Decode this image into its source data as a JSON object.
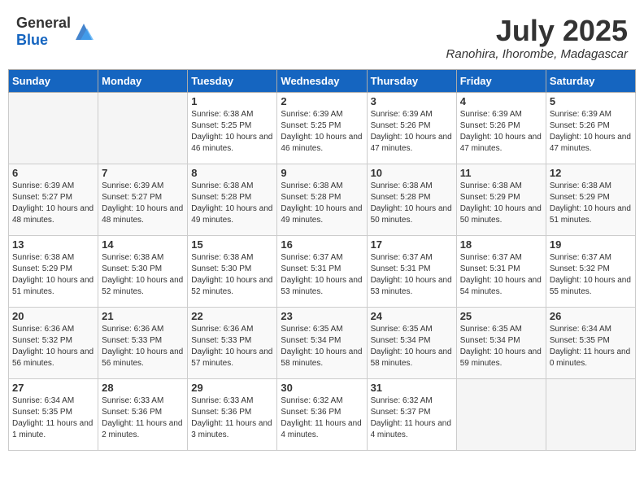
{
  "header": {
    "logo_general": "General",
    "logo_blue": "Blue",
    "month_year": "July 2025",
    "location": "Ranohira, Ihorombe, Madagascar"
  },
  "days_of_week": [
    "Sunday",
    "Monday",
    "Tuesday",
    "Wednesday",
    "Thursday",
    "Friday",
    "Saturday"
  ],
  "weeks": [
    [
      {
        "day": "",
        "empty": true
      },
      {
        "day": "",
        "empty": true
      },
      {
        "day": "1",
        "sunrise": "6:38 AM",
        "sunset": "5:25 PM",
        "daylight": "10 hours and 46 minutes."
      },
      {
        "day": "2",
        "sunrise": "6:39 AM",
        "sunset": "5:25 PM",
        "daylight": "10 hours and 46 minutes."
      },
      {
        "day": "3",
        "sunrise": "6:39 AM",
        "sunset": "5:26 PM",
        "daylight": "10 hours and 47 minutes."
      },
      {
        "day": "4",
        "sunrise": "6:39 AM",
        "sunset": "5:26 PM",
        "daylight": "10 hours and 47 minutes."
      },
      {
        "day": "5",
        "sunrise": "6:39 AM",
        "sunset": "5:26 PM",
        "daylight": "10 hours and 47 minutes."
      }
    ],
    [
      {
        "day": "6",
        "sunrise": "6:39 AM",
        "sunset": "5:27 PM",
        "daylight": "10 hours and 48 minutes."
      },
      {
        "day": "7",
        "sunrise": "6:39 AM",
        "sunset": "5:27 PM",
        "daylight": "10 hours and 48 minutes."
      },
      {
        "day": "8",
        "sunrise": "6:38 AM",
        "sunset": "5:28 PM",
        "daylight": "10 hours and 49 minutes."
      },
      {
        "day": "9",
        "sunrise": "6:38 AM",
        "sunset": "5:28 PM",
        "daylight": "10 hours and 49 minutes."
      },
      {
        "day": "10",
        "sunrise": "6:38 AM",
        "sunset": "5:28 PM",
        "daylight": "10 hours and 50 minutes."
      },
      {
        "day": "11",
        "sunrise": "6:38 AM",
        "sunset": "5:29 PM",
        "daylight": "10 hours and 50 minutes."
      },
      {
        "day": "12",
        "sunrise": "6:38 AM",
        "sunset": "5:29 PM",
        "daylight": "10 hours and 51 minutes."
      }
    ],
    [
      {
        "day": "13",
        "sunrise": "6:38 AM",
        "sunset": "5:29 PM",
        "daylight": "10 hours and 51 minutes."
      },
      {
        "day": "14",
        "sunrise": "6:38 AM",
        "sunset": "5:30 PM",
        "daylight": "10 hours and 52 minutes."
      },
      {
        "day": "15",
        "sunrise": "6:38 AM",
        "sunset": "5:30 PM",
        "daylight": "10 hours and 52 minutes."
      },
      {
        "day": "16",
        "sunrise": "6:37 AM",
        "sunset": "5:31 PM",
        "daylight": "10 hours and 53 minutes."
      },
      {
        "day": "17",
        "sunrise": "6:37 AM",
        "sunset": "5:31 PM",
        "daylight": "10 hours and 53 minutes."
      },
      {
        "day": "18",
        "sunrise": "6:37 AM",
        "sunset": "5:31 PM",
        "daylight": "10 hours and 54 minutes."
      },
      {
        "day": "19",
        "sunrise": "6:37 AM",
        "sunset": "5:32 PM",
        "daylight": "10 hours and 55 minutes."
      }
    ],
    [
      {
        "day": "20",
        "sunrise": "6:36 AM",
        "sunset": "5:32 PM",
        "daylight": "10 hours and 56 minutes."
      },
      {
        "day": "21",
        "sunrise": "6:36 AM",
        "sunset": "5:33 PM",
        "daylight": "10 hours and 56 minutes."
      },
      {
        "day": "22",
        "sunrise": "6:36 AM",
        "sunset": "5:33 PM",
        "daylight": "10 hours and 57 minutes."
      },
      {
        "day": "23",
        "sunrise": "6:35 AM",
        "sunset": "5:34 PM",
        "daylight": "10 hours and 58 minutes."
      },
      {
        "day": "24",
        "sunrise": "6:35 AM",
        "sunset": "5:34 PM",
        "daylight": "10 hours and 58 minutes."
      },
      {
        "day": "25",
        "sunrise": "6:35 AM",
        "sunset": "5:34 PM",
        "daylight": "10 hours and 59 minutes."
      },
      {
        "day": "26",
        "sunrise": "6:34 AM",
        "sunset": "5:35 PM",
        "daylight": "11 hours and 0 minutes."
      }
    ],
    [
      {
        "day": "27",
        "sunrise": "6:34 AM",
        "sunset": "5:35 PM",
        "daylight": "11 hours and 1 minute."
      },
      {
        "day": "28",
        "sunrise": "6:33 AM",
        "sunset": "5:36 PM",
        "daylight": "11 hours and 2 minutes."
      },
      {
        "day": "29",
        "sunrise": "6:33 AM",
        "sunset": "5:36 PM",
        "daylight": "11 hours and 3 minutes."
      },
      {
        "day": "30",
        "sunrise": "6:32 AM",
        "sunset": "5:36 PM",
        "daylight": "11 hours and 4 minutes."
      },
      {
        "day": "31",
        "sunrise": "6:32 AM",
        "sunset": "5:37 PM",
        "daylight": "11 hours and 4 minutes."
      },
      {
        "day": "",
        "empty": true
      },
      {
        "day": "",
        "empty": true
      }
    ]
  ]
}
